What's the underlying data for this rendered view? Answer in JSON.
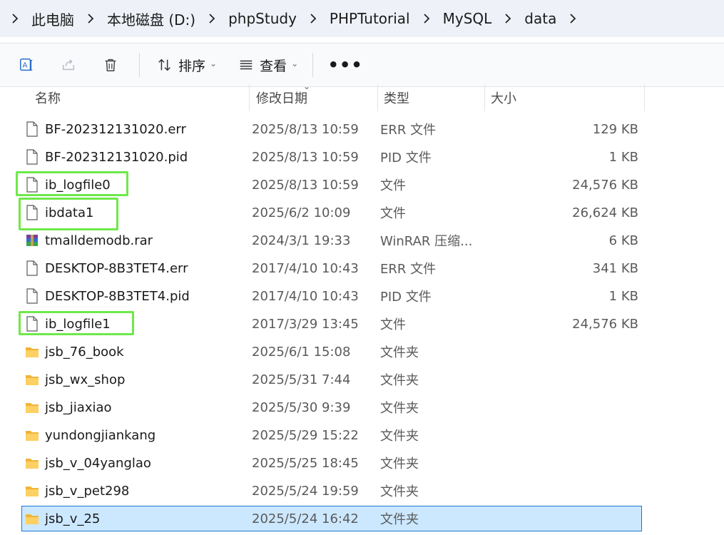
{
  "breadcrumb": [
    "此电脑",
    "本地磁盘 (D:)",
    "phpStudy",
    "PHPTutorial",
    "MySQL",
    "data"
  ],
  "toolbar": {
    "icons": [
      "rename-icon",
      "share-icon",
      "delete-icon"
    ],
    "sort_label": "排序",
    "view_label": "查看",
    "more_label": "•••"
  },
  "columns": {
    "name": "名称",
    "date": "修改日期",
    "type": "类型",
    "size": "大小"
  },
  "files": [
    {
      "name": "BF-202312131020.err",
      "date": "2025/8/13 10:59",
      "type": "ERR 文件",
      "size": "129 KB",
      "icon": "file-icon"
    },
    {
      "name": "BF-202312131020.pid",
      "date": "2025/8/13 10:59",
      "type": "PID 文件",
      "size": "1 KB",
      "icon": "file-icon"
    },
    {
      "name": "ib_logfile0",
      "date": "2025/8/13 10:59",
      "type": "文件",
      "size": "24,576 KB",
      "icon": "file-icon"
    },
    {
      "name": "ibdata1",
      "date": "2025/6/2 10:09",
      "type": "文件",
      "size": "26,624 KB",
      "icon": "file-icon"
    },
    {
      "name": "tmalldemodb.rar",
      "date": "2024/3/1 19:33",
      "type": "WinRAR 压缩...",
      "size": "6 KB",
      "icon": "rar-icon"
    },
    {
      "name": "DESKTOP-8B3TET4.err",
      "date": "2017/4/10 10:43",
      "type": "ERR 文件",
      "size": "341 KB",
      "icon": "file-icon"
    },
    {
      "name": "DESKTOP-8B3TET4.pid",
      "date": "2017/4/10 10:43",
      "type": "PID 文件",
      "size": "1 KB",
      "icon": "file-icon"
    },
    {
      "name": "ib_logfile1",
      "date": "2017/3/29 13:45",
      "type": "文件",
      "size": "24,576 KB",
      "icon": "file-icon"
    },
    {
      "name": "jsb_76_book",
      "date": "2025/6/1 15:08",
      "type": "文件夹",
      "size": "",
      "icon": "folder-icon"
    },
    {
      "name": "jsb_wx_shop",
      "date": "2025/5/31 7:44",
      "type": "文件夹",
      "size": "",
      "icon": "folder-icon"
    },
    {
      "name": "jsb_jiaxiao",
      "date": "2025/5/30 9:39",
      "type": "文件夹",
      "size": "",
      "icon": "folder-icon"
    },
    {
      "name": "yundongjiankang",
      "date": "2025/5/29 15:22",
      "type": "文件夹",
      "size": "",
      "icon": "folder-icon"
    },
    {
      "name": "jsb_v_04yanglao",
      "date": "2025/5/25 18:45",
      "type": "文件夹",
      "size": "",
      "icon": "folder-icon"
    },
    {
      "name": "jsb_v_pet298",
      "date": "2025/5/24 19:59",
      "type": "文件夹",
      "size": "",
      "icon": "folder-icon"
    },
    {
      "name": "jsb_v_25",
      "date": "2025/5/24 16:42",
      "type": "文件夹",
      "size": "",
      "icon": "folder-icon",
      "selected": true
    }
  ],
  "colors": {
    "highlight": "#6ee84a",
    "selection_bg": "#cce8ff",
    "selection_border": "#1c76d2",
    "folder": "#f5c04a"
  }
}
